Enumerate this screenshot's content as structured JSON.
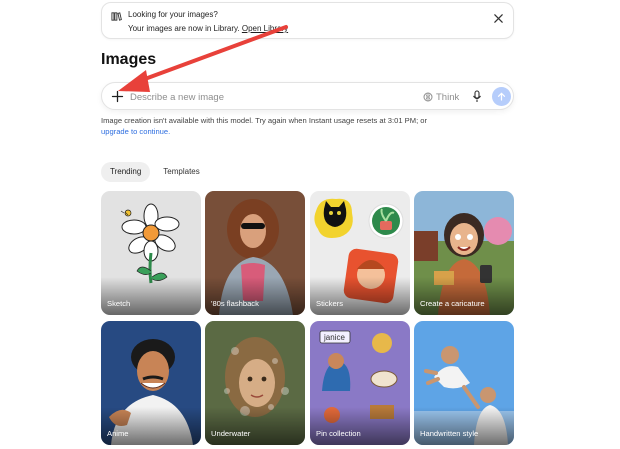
{
  "banner": {
    "title": "Looking for your images?",
    "text": "Your images are now in Library.",
    "link": "Open Library",
    "icon": "library-icon",
    "close_icon": "close-icon"
  },
  "page": {
    "title": "Images"
  },
  "prompt": {
    "placeholder": "Describe a new image",
    "think_label": "Think",
    "plus_icon": "plus-icon",
    "mic_icon": "microphone-icon",
    "send_icon": "arrow-up-icon",
    "send_color": "#b6cdfb"
  },
  "notice": {
    "text": "Image creation isn't available with this model. Try again when Instant usage resets at 3:01 PM; or",
    "link": "upgrade to continue."
  },
  "tabs": [
    {
      "label": "Trending",
      "active": true
    },
    {
      "label": "Templates",
      "active": false
    }
  ],
  "tiles": [
    {
      "label": "Sketch"
    },
    {
      "label": "'80s flashback"
    },
    {
      "label": "Stickers"
    },
    {
      "label": "Create a caricature"
    },
    {
      "label": "Anime"
    },
    {
      "label": "Underwater"
    },
    {
      "label": "Pin collection"
    },
    {
      "label": "Handwritten style"
    }
  ],
  "annotation": {
    "color": "#e8413a"
  }
}
